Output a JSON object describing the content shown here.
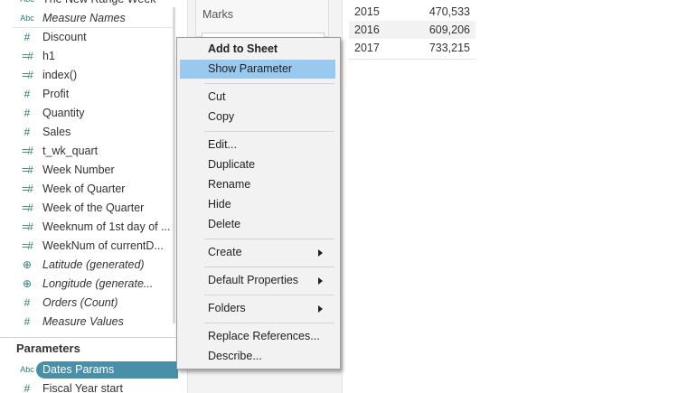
{
  "left_pane": {
    "fields": [
      {
        "icon": "Abc",
        "label": "The New Range Week",
        "italic": false,
        "kind": "abc"
      },
      {
        "icon": "Abc",
        "label": "Measure Names",
        "italic": true,
        "kind": "abc"
      },
      {
        "icon": "#",
        "label": "Discount",
        "italic": false,
        "kind": "num"
      },
      {
        "icon": "=#",
        "label": "h1",
        "italic": false,
        "kind": "calc"
      },
      {
        "icon": "=#",
        "label": "index()",
        "italic": false,
        "kind": "calc"
      },
      {
        "icon": "#",
        "label": "Profit",
        "italic": false,
        "kind": "num"
      },
      {
        "icon": "#",
        "label": "Quantity",
        "italic": false,
        "kind": "num"
      },
      {
        "icon": "#",
        "label": "Sales",
        "italic": false,
        "kind": "num"
      },
      {
        "icon": "=#",
        "label": "t_wk_quart",
        "italic": false,
        "kind": "calc"
      },
      {
        "icon": "=#",
        "label": "Week Number",
        "italic": false,
        "kind": "calc"
      },
      {
        "icon": "=#",
        "label": "Week of Quarter",
        "italic": false,
        "kind": "calc"
      },
      {
        "icon": "=#",
        "label": "Week of the Quarter",
        "italic": false,
        "kind": "calc"
      },
      {
        "icon": "=#",
        "label": "Weeknum of 1st day of ...",
        "italic": false,
        "kind": "calc"
      },
      {
        "icon": "=#",
        "label": "WeekNum of currentD...",
        "italic": false,
        "kind": "calc"
      },
      {
        "icon": "⊕",
        "label": "Latitude (generated)",
        "italic": true,
        "kind": "geo"
      },
      {
        "icon": "⊕",
        "label": "Longitude (generate...",
        "italic": true,
        "kind": "geo"
      },
      {
        "icon": "#",
        "label": "Orders (Count)",
        "italic": true,
        "kind": "num"
      },
      {
        "icon": "#",
        "label": "Measure Values",
        "italic": true,
        "kind": "num"
      }
    ],
    "parameters_title": "Parameters",
    "parameters": [
      {
        "icon": "Abc",
        "label": "Dates Params"
      },
      {
        "icon": "#",
        "label": "Fiscal Year start"
      }
    ]
  },
  "marks": {
    "title": "Marks"
  },
  "table": {
    "rows": [
      {
        "year": "2015",
        "value": "470,533"
      },
      {
        "year": "2016",
        "value": "609,206"
      },
      {
        "year": "2017",
        "value": "733,215"
      }
    ]
  },
  "context_menu": {
    "items": [
      {
        "label": "Add to Sheet"
      },
      {
        "label": "Show Parameter"
      },
      {
        "label": "Cut"
      },
      {
        "label": "Copy"
      },
      {
        "label": "Edit..."
      },
      {
        "label": "Duplicate"
      },
      {
        "label": "Rename"
      },
      {
        "label": "Hide"
      },
      {
        "label": "Delete"
      },
      {
        "label": "Create"
      },
      {
        "label": "Default Properties"
      },
      {
        "label": "Folders"
      },
      {
        "label": "Replace References..."
      },
      {
        "label": "Describe..."
      }
    ],
    "highlight_color": "#99c9ef"
  },
  "colors": {
    "accent": "#4a8fa8",
    "field_icon": "#2a7a6f"
  }
}
